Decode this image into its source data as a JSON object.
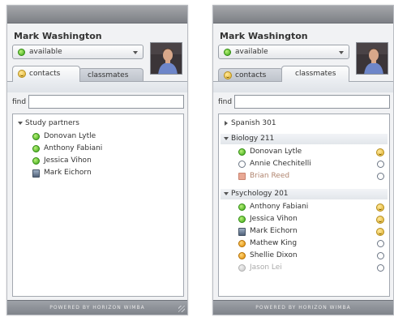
{
  "left": {
    "user_name": "Mark Washington",
    "status": "available",
    "tabs": [
      {
        "label": "contacts",
        "active": true
      },
      {
        "label": "classmates",
        "active": false
      }
    ],
    "find_label": "find",
    "find_value": "",
    "groups": [
      {
        "name": "Study partners",
        "expanded": true,
        "contacts": [
          {
            "name": "Donovan Lytle",
            "status": "green"
          },
          {
            "name": "Anthony Fabiani",
            "status": "green"
          },
          {
            "name": "Jessica Vihon",
            "status": "green"
          },
          {
            "name": "Mark Eichorn",
            "status": "mobile"
          }
        ]
      }
    ],
    "footer": "POWERED BY HORIZON WIMBA"
  },
  "right": {
    "user_name": "Mark Washington",
    "status": "available",
    "tabs": [
      {
        "label": "contacts",
        "active": false
      },
      {
        "label": "classmates",
        "active": true
      }
    ],
    "find_label": "find",
    "find_value": "",
    "groups": [
      {
        "name": "Spanish 301",
        "expanded": false,
        "contacts": []
      },
      {
        "name": "Biology 211",
        "expanded": true,
        "contacts": [
          {
            "name": "Donovan Lytle",
            "status": "green",
            "side": "smiley"
          },
          {
            "name": "Annie Chechitelli",
            "status": "ring",
            "side": "ring"
          },
          {
            "name": "Brian Reed",
            "status": "pink",
            "side": "ring"
          }
        ]
      },
      {
        "name": "Psychology 201",
        "expanded": true,
        "contacts": [
          {
            "name": "Anthony Fabiani",
            "status": "green",
            "side": "smiley"
          },
          {
            "name": "Jessica Vihon",
            "status": "green",
            "side": "smiley"
          },
          {
            "name": "Mark Eichorn",
            "status": "mobile",
            "side": "smiley"
          },
          {
            "name": "Mathew King",
            "status": "orange",
            "side": "ring"
          },
          {
            "name": "Shellie Dixon",
            "status": "orange",
            "side": "ring"
          },
          {
            "name": "Jason Lei",
            "status": "gray",
            "side": "ring"
          }
        ]
      }
    ],
    "footer": "POWERED BY HORIZON WIMBA"
  },
  "colors": {
    "titlebar": "#8c8f94",
    "available": "#3aa514",
    "away": "#e08a00",
    "offline": "#c6c6c6",
    "footer": "#8f9399"
  },
  "icons": {
    "status_select": "green-dot-icon",
    "dropdown": "chevron-down-icon",
    "contacts_tab": "smiley-icon",
    "expand": "triangle-down-icon",
    "collapse": "triangle-right-icon"
  }
}
